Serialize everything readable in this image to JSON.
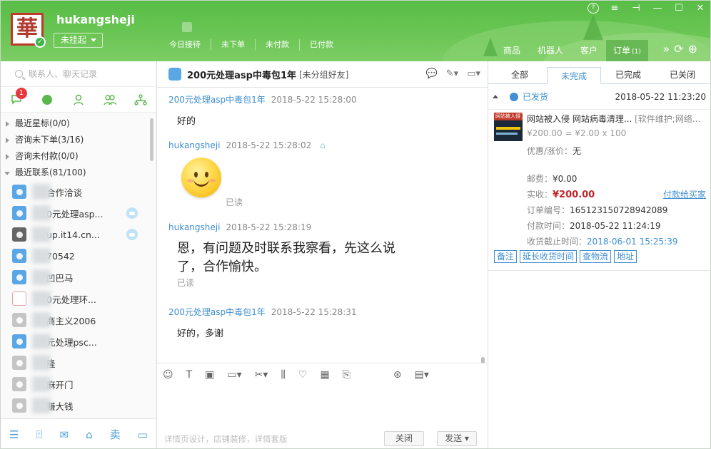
{
  "header": {
    "logo_char": "華",
    "username": "hukangsheji",
    "status": "未挂起",
    "stats": [
      "今日接待",
      "未下单",
      "未付款",
      "已付款"
    ],
    "nav": [
      {
        "label": "商品"
      },
      {
        "label": "机器人"
      },
      {
        "label": "客户"
      },
      {
        "label": "订单",
        "count": "(1)"
      }
    ],
    "window_controls": [
      "?",
      "≡",
      "⊣",
      "—",
      "☐",
      "✕"
    ]
  },
  "left": {
    "search_placeholder": "联系人、聊天记录",
    "tab_badge": "1",
    "groups": [
      {
        "label": "最近星标(0/0)",
        "open": false
      },
      {
        "label": "咨询未下单(3/16)",
        "open": false
      },
      {
        "label": "咨询未付款(0/0)",
        "open": false
      },
      {
        "label": "最近联系(81/100)",
        "open": true
      }
    ],
    "contacts": [
      {
        "name": "合作洽谈",
        "avatar": "blue",
        "tag": false
      },
      {
        "name": "0元处理asp...",
        "avatar": "blue",
        "tag": true
      },
      {
        "name": "up.it14.cn...",
        "avatar": "dark",
        "tag": true
      },
      {
        "name": "70542",
        "avatar": "blue",
        "tag": false
      },
      {
        "name": "凹巴马",
        "avatar": "blue",
        "tag": false
      },
      {
        "name": "0元处理环...",
        "avatar": "logo2",
        "tag": false
      },
      {
        "name": "商主义2006",
        "avatar": "gray",
        "tag": false
      },
      {
        "name": "元处理psc...",
        "avatar": "blue",
        "tag": false
      },
      {
        "name": "隆",
        "avatar": "gray",
        "tag": false
      },
      {
        "name": "麻开门",
        "avatar": "gray",
        "tag": false
      },
      {
        "name": "赚大钱",
        "avatar": "gray",
        "tag": false
      }
    ],
    "bottom_seller_label": "卖"
  },
  "chat": {
    "title": "200元处理asp中毒包1年",
    "group": "[未分组好友]",
    "messages": [
      {
        "sender": "200元处理asp中毒包1年",
        "time": "2018-5-22 15:28:00",
        "text": "好的",
        "mine": false
      },
      {
        "sender": "hukangsheji",
        "time": "2018-5-22 15:28:02",
        "text": "",
        "mine": true,
        "read": "已读"
      },
      {
        "sender": "hukangsheji",
        "time": "2018-5-22 15:28:19",
        "text": "恩，有问题及时联系我察看，先这么说了，合作愉快。",
        "mine": true,
        "read": "已读"
      },
      {
        "sender": "200元处理asp中毒包1年",
        "time": "2018-5-22 15:28:31",
        "text": "好的，多谢",
        "mine": false
      }
    ],
    "input_hint": "详情页设计，店铺装修，详情套版",
    "close_label": "关闭",
    "send_label": "发送"
  },
  "orders": {
    "tabs": [
      "全部",
      "未完成",
      "已完成",
      "已关闭"
    ],
    "active_tab": 1,
    "status": "已发货",
    "date": "2018-05-22 11:23:20",
    "item": {
      "title": "网站被入侵 网站病毒清理...",
      "category": "[软件维护;网络...",
      "price": "¥200.00 = ¥2.00 x 100",
      "thumb_text": "网站被入侵了"
    },
    "discount_label": "优惠/涨价：",
    "discount_value": "无",
    "shipping_label": "邮费：",
    "shipping_value": "¥0.00",
    "paid_label": "实收：",
    "paid_value": "¥200.00",
    "pay_link": "付款给买家",
    "order_no_label": "订单编号：",
    "order_no": "165123150728942089",
    "pay_time_label": "付款时间：",
    "pay_time": "2018-05-22 11:24:19",
    "deadline_label": "收货截止时间：",
    "deadline": "2018-06-01 15:25:39",
    "actions": [
      "备注",
      "延长收货时间",
      "查物流",
      "地址"
    ]
  }
}
